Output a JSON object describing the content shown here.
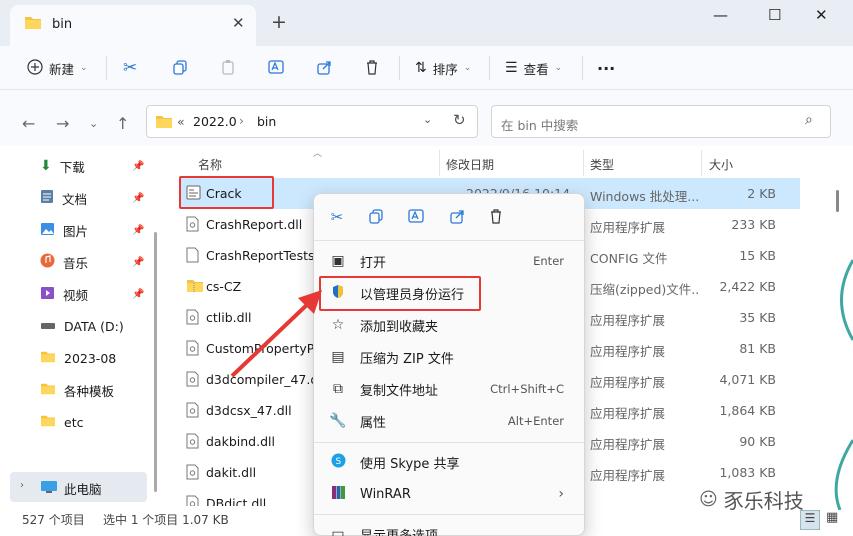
{
  "tab": {
    "title": "bin",
    "new_tab": "+"
  },
  "window_controls": {
    "minimize": "—",
    "maximize": "☐",
    "close": "✕"
  },
  "toolbar": {
    "new_label": "新建",
    "sort_label": "排序",
    "view_label": "查看",
    "more": "···"
  },
  "address": {
    "prefix": "«",
    "crumbs": [
      "2022.0",
      "bin"
    ],
    "separator": "›"
  },
  "search": {
    "placeholder": "在 bin 中搜索"
  },
  "sidebar": {
    "items": [
      {
        "label": "下载",
        "icon": "download-icon",
        "pinned": true
      },
      {
        "label": "文档",
        "icon": "document-icon",
        "pinned": true
      },
      {
        "label": "图片",
        "icon": "picture-icon",
        "pinned": true
      },
      {
        "label": "音乐",
        "icon": "music-icon",
        "pinned": true
      },
      {
        "label": "视频",
        "icon": "video-icon",
        "pinned": true
      },
      {
        "label": "DATA (D:)",
        "icon": "drive-icon",
        "pinned": false
      },
      {
        "label": "2023-08",
        "icon": "folder-icon",
        "pinned": false
      },
      {
        "label": "各种模板",
        "icon": "folder-icon",
        "pinned": false
      },
      {
        "label": "etc",
        "icon": "folder-icon",
        "pinned": false
      }
    ],
    "this_pc": "此电脑"
  },
  "columns": {
    "name": "名称",
    "date": "修改日期",
    "type": "类型",
    "size": "大小"
  },
  "files": [
    {
      "name": "Crack",
      "date": "2022/9/16 10:14",
      "type": "Windows 批处理...",
      "size": "2 KB",
      "kind": "bat",
      "selected": true
    },
    {
      "name": "CrashReport.dll",
      "date": "",
      "type": "应用程序扩展",
      "size": "233 KB",
      "kind": "dll"
    },
    {
      "name": "CrashReportTests.",
      "date": "",
      "type": "CONFIG 文件",
      "size": "15 KB",
      "kind": "file"
    },
    {
      "name": "cs-CZ",
      "date": "",
      "type": "压缩(zipped)文件...",
      "size": "2,422 KB",
      "kind": "zip"
    },
    {
      "name": "ctlib.dll",
      "date": "",
      "type": "应用程序扩展",
      "size": "35 KB",
      "kind": "dll"
    },
    {
      "name": "CustomPropertyPl",
      "date": "",
      "type": "应用程序扩展",
      "size": "81 KB",
      "kind": "dll"
    },
    {
      "name": "d3dcompiler_47.dl",
      "date": "",
      "type": "应用程序扩展",
      "size": "4,071 KB",
      "kind": "dll"
    },
    {
      "name": "d3dcsx_47.dll",
      "date": "",
      "type": "应用程序扩展",
      "size": "1,864 KB",
      "kind": "dll"
    },
    {
      "name": "dakbind.dll",
      "date": "",
      "type": "应用程序扩展",
      "size": "90 KB",
      "kind": "dll"
    },
    {
      "name": "dakit.dll",
      "date": "",
      "type": "应用程序扩展",
      "size": "1,083 KB",
      "kind": "dll"
    },
    {
      "name": "DBdict.dll",
      "date": "",
      "type": "",
      "size": "",
      "kind": "dll"
    }
  ],
  "status": {
    "count": "527 个项目",
    "selected": "选中 1 个项目 1.07 KB"
  },
  "context_menu": {
    "items": [
      {
        "label": "打开",
        "shortcut": "Enter",
        "icon": "open-icon"
      },
      {
        "label": "以管理员身份运行",
        "shortcut": "",
        "icon": "shield-icon"
      },
      {
        "label": "添加到收藏夹",
        "shortcut": "",
        "icon": "star-icon"
      },
      {
        "label": "压缩为 ZIP 文件",
        "shortcut": "",
        "icon": "zip-icon"
      },
      {
        "label": "复制文件地址",
        "shortcut": "Ctrl+Shift+C",
        "icon": "copy-path-icon"
      },
      {
        "label": "属性",
        "shortcut": "Alt+Enter",
        "icon": "wrench-icon"
      }
    ],
    "items2": [
      {
        "label": "使用 Skype 共享",
        "icon": "skype-icon"
      },
      {
        "label": "WinRAR",
        "icon": "winrar-icon",
        "submenu": "›"
      }
    ],
    "more": "显示更多选项"
  },
  "watermark": "豕乐科技",
  "colors": {
    "selection": "#cce8ff",
    "highlight_box": "#e53935",
    "arrow": "#e53935",
    "accent": "#2b78d6"
  }
}
